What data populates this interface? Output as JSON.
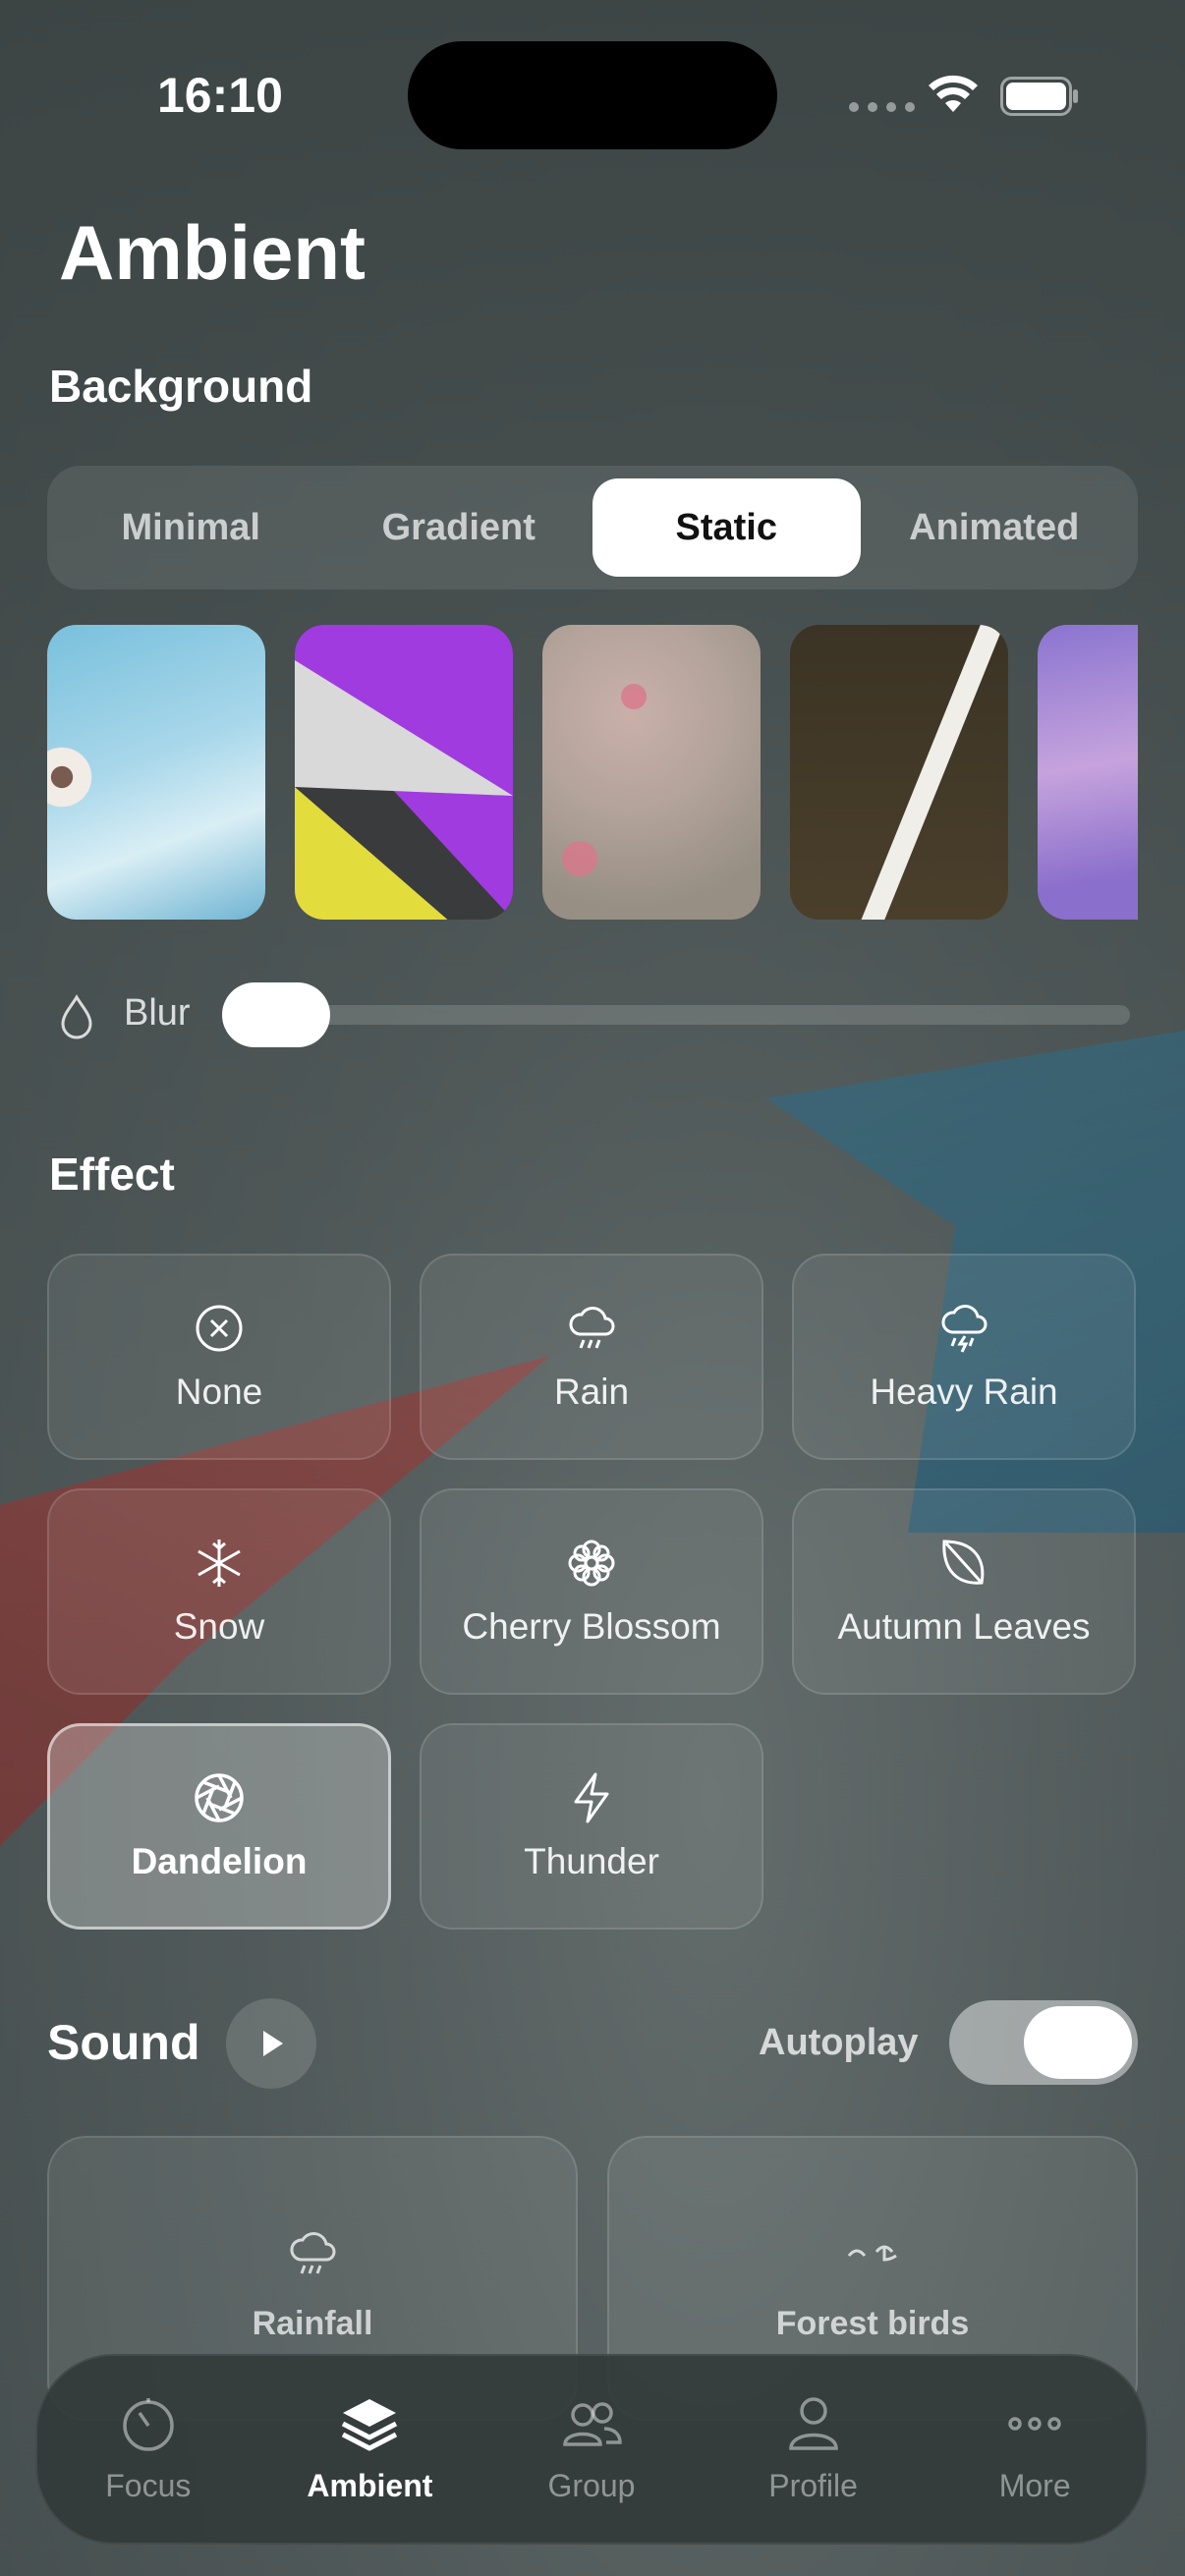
{
  "status_bar": {
    "time": "16:10"
  },
  "page": {
    "title": "Ambient"
  },
  "background": {
    "section_title": "Background",
    "segments": [
      {
        "label": "Minimal",
        "active": false
      },
      {
        "label": "Gradient",
        "active": false
      },
      {
        "label": "Static",
        "active": true
      },
      {
        "label": "Animated",
        "active": false
      }
    ],
    "thumbnails": [
      "sky-flower",
      "geometric-paper",
      "pink-blossom",
      "dark-light-beam",
      "purple-clouds"
    ],
    "blur": {
      "label": "Blur",
      "value": 0
    }
  },
  "effect": {
    "section_title": "Effect",
    "items": [
      {
        "label": "None",
        "icon": "x-circle-icon",
        "selected": false
      },
      {
        "label": "Rain",
        "icon": "rain-cloud-icon",
        "selected": false
      },
      {
        "label": "Heavy Rain",
        "icon": "storm-cloud-icon",
        "selected": false
      },
      {
        "label": "Snow",
        "icon": "snowflake-icon",
        "selected": false
      },
      {
        "label": "Cherry Blossom",
        "icon": "flower-icon",
        "selected": false
      },
      {
        "label": "Autumn Leaves",
        "icon": "leaf-icon",
        "selected": false
      },
      {
        "label": "Dandelion",
        "icon": "aperture-icon",
        "selected": true
      },
      {
        "label": "Thunder",
        "icon": "bolt-icon",
        "selected": false
      }
    ]
  },
  "sound": {
    "section_title": "Sound",
    "autoplay_label": "Autoplay",
    "autoplay_on": true,
    "items": [
      {
        "label": "Rainfall",
        "icon": "rain-cloud-icon"
      },
      {
        "label": "Forest birds",
        "icon": "birds-icon"
      }
    ]
  },
  "tabbar": {
    "items": [
      {
        "label": "Focus",
        "icon": "timer-icon",
        "active": false
      },
      {
        "label": "Ambient",
        "icon": "layers-icon",
        "active": true
      },
      {
        "label": "Group",
        "icon": "group-icon",
        "active": false
      },
      {
        "label": "Profile",
        "icon": "person-icon",
        "active": false
      },
      {
        "label": "More",
        "icon": "ellipsis-icon",
        "active": false
      }
    ]
  }
}
